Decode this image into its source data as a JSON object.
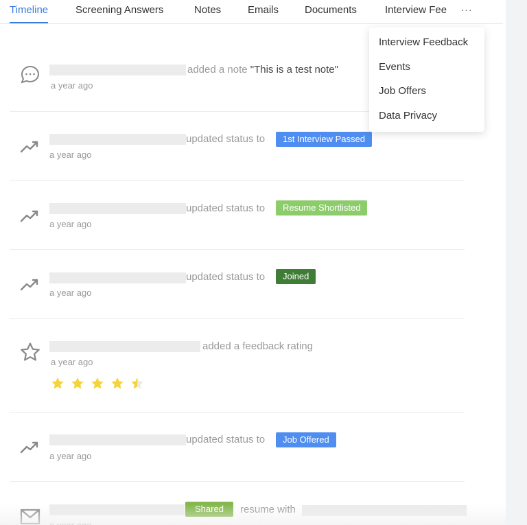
{
  "tabs": [
    {
      "label": "Timeline",
      "active": true
    },
    {
      "label": "Screening Answers",
      "active": false
    },
    {
      "label": "Notes",
      "active": false
    },
    {
      "label": "Emails",
      "active": false
    },
    {
      "label": "Documents",
      "active": false
    },
    {
      "label": "Interview Fee",
      "active": false
    }
  ],
  "more_label": "···",
  "dropdown": {
    "items": [
      "Interview Feedback",
      "Events",
      "Job Offers",
      "Data Privacy"
    ]
  },
  "colors": {
    "accent": "#3a7be0",
    "badge_blue": "#4f8ef0",
    "badge_light_green": "#8ccc6a",
    "badge_dark_green": "#3f7d36",
    "badge_olive_green": "#85b84e",
    "star_gold": "#f5d33c",
    "star_empty": "#e8e8e8"
  },
  "timeline": [
    {
      "icon": "comment-icon",
      "action": "added a note",
      "note": "\"This is a test note\"",
      "time": "a year ago"
    },
    {
      "icon": "trend-up-icon",
      "action": "updated status to",
      "badge": "1st Interview Passed",
      "badge_color": "#4f8ef0",
      "time": "a year ago"
    },
    {
      "icon": "trend-up-icon",
      "action": "updated status to",
      "badge": "Resume Shortlisted",
      "badge_color": "#8ccc6a",
      "time": "a year ago"
    },
    {
      "icon": "trend-up-icon",
      "action": "updated status to",
      "badge": "Joined",
      "badge_color": "#3f7d36",
      "time": "a year ago"
    },
    {
      "icon": "star-outline-icon",
      "action": "added a feedback rating",
      "rating": 4.5,
      "rating_max": 5,
      "time": "a year ago"
    },
    {
      "icon": "trend-up-icon",
      "action": "updated status to",
      "badge": "Job Offered",
      "badge_color": "#4f8ef0",
      "time": "a year ago"
    },
    {
      "icon": "mail-icon",
      "badge": "Shared",
      "badge_color": "#85b84e",
      "action": "resume with",
      "time": "a year ago"
    }
  ]
}
